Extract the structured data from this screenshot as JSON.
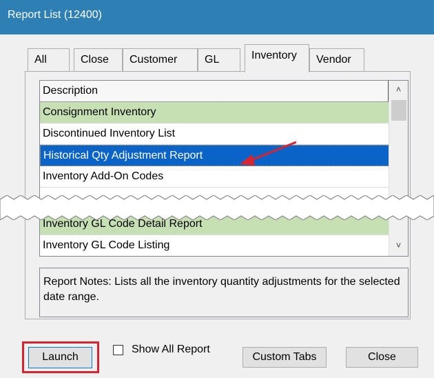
{
  "window": {
    "title": "Report List (12400)"
  },
  "tabs": [
    {
      "label": "All",
      "active": false
    },
    {
      "label": "Close",
      "active": false
    },
    {
      "label": "Customer",
      "active": false
    },
    {
      "label": "GL",
      "active": false
    },
    {
      "label": "Inventory",
      "active": true
    },
    {
      "label": "Vendor",
      "active": false
    }
  ],
  "list": {
    "header": "Description",
    "rows": [
      {
        "label": "Consignment Inventory",
        "style": "green"
      },
      {
        "label": "Discontinued Inventory List",
        "style": "white"
      },
      {
        "label": "Historical Qty Adjustment Report",
        "style": "selected"
      },
      {
        "label": "Inventory Add-On Codes",
        "style": "white"
      },
      {
        "label": "Inventory GL Code Detail Report",
        "style": "green"
      },
      {
        "label": "Inventory GL Code Listing",
        "style": "white"
      }
    ]
  },
  "notes": {
    "text": "Report Notes:  Lists all the inventory quantity adjustments for the selected date range."
  },
  "buttons": {
    "launch": "Launch",
    "show_all_label": "Show All Report",
    "show_all_checked": false,
    "custom_tabs": "Custom Tabs",
    "close": "Close"
  },
  "icons": {
    "scroll_up": "chevron-up-icon",
    "scroll_down": "chevron-down-icon",
    "arrow": "red-arrow-icon"
  },
  "colors": {
    "titlebar": "#2e7fb4",
    "selected_row": "#0a64c8",
    "green_row": "#c6e0b4",
    "highlight_outline": "#d9232f"
  }
}
